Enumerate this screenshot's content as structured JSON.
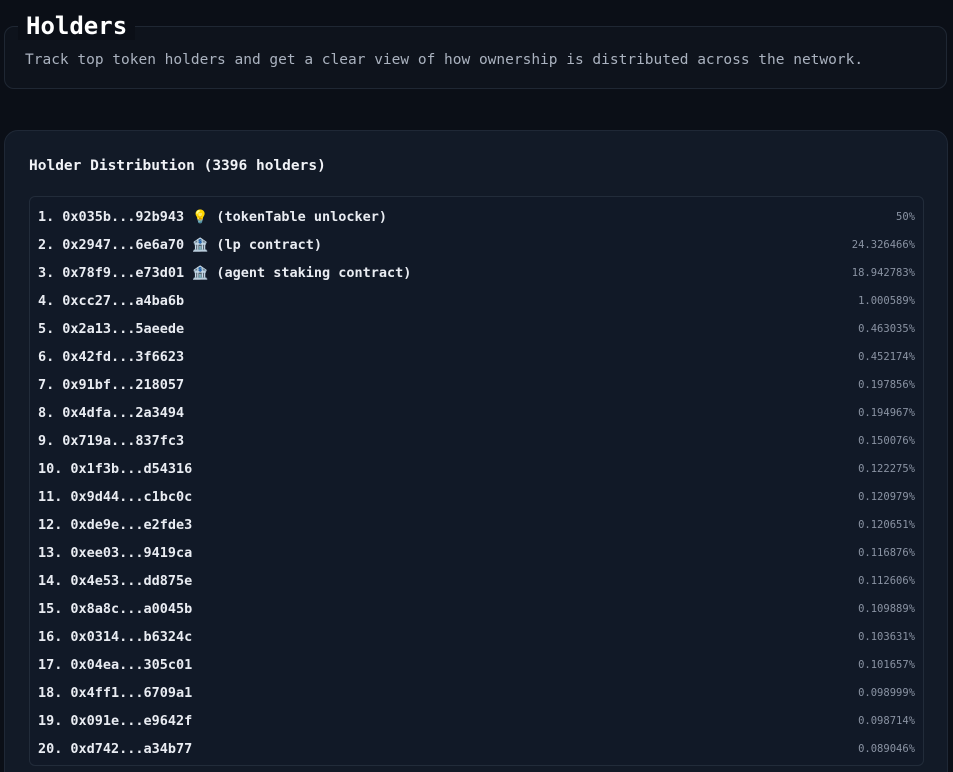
{
  "header": {
    "title": "Holders",
    "subtitle": "Track top token holders and get a clear view of how ownership is distributed across the network."
  },
  "distribution": {
    "title": "Holder Distribution (3396 holders)",
    "holders": [
      {
        "rank": "1.",
        "address": "0x035b...92b943",
        "icon": "lightbulb-icon",
        "icon_glyph": "💡",
        "tag": "(tokenTable unlocker)",
        "percent": "50%"
      },
      {
        "rank": "2.",
        "address": "0x2947...6e6a70",
        "icon": "bank-icon",
        "icon_glyph": "🏦",
        "tag": "(lp contract)",
        "percent": "24.326466%"
      },
      {
        "rank": "3.",
        "address": "0x78f9...e73d01",
        "icon": "bank-icon",
        "icon_glyph": "🏦",
        "tag": "(agent staking contract)",
        "percent": "18.942783%"
      },
      {
        "rank": "4.",
        "address": "0xcc27...a4ba6b",
        "percent": "1.000589%"
      },
      {
        "rank": "5.",
        "address": "0x2a13...5aeede",
        "percent": "0.463035%"
      },
      {
        "rank": "6.",
        "address": "0x42fd...3f6623",
        "percent": "0.452174%"
      },
      {
        "rank": "7.",
        "address": "0x91bf...218057",
        "percent": "0.197856%"
      },
      {
        "rank": "8.",
        "address": "0x4dfa...2a3494",
        "percent": "0.194967%"
      },
      {
        "rank": "9.",
        "address": "0x719a...837fc3",
        "percent": "0.150076%"
      },
      {
        "rank": "10.",
        "address": "0x1f3b...d54316",
        "percent": "0.122275%"
      },
      {
        "rank": "11.",
        "address": "0x9d44...c1bc0c",
        "percent": "0.120979%"
      },
      {
        "rank": "12.",
        "address": "0xde9e...e2fde3",
        "percent": "0.120651%"
      },
      {
        "rank": "13.",
        "address": "0xee03...9419ca",
        "percent": "0.116876%"
      },
      {
        "rank": "14.",
        "address": "0x4e53...dd875e",
        "percent": "0.112606%"
      },
      {
        "rank": "15.",
        "address": "0x8a8c...a0045b",
        "percent": "0.109889%"
      },
      {
        "rank": "16.",
        "address": "0x0314...b6324c",
        "percent": "0.103631%"
      },
      {
        "rank": "17.",
        "address": "0x04ea...305c01",
        "percent": "0.101657%"
      },
      {
        "rank": "18.",
        "address": "0x4ff1...6709a1",
        "percent": "0.098999%"
      },
      {
        "rank": "19.",
        "address": "0x091e...e9642f",
        "percent": "0.098714%"
      },
      {
        "rank": "20.",
        "address": "0xd742...a34b77",
        "percent": "0.089046%"
      }
    ]
  }
}
